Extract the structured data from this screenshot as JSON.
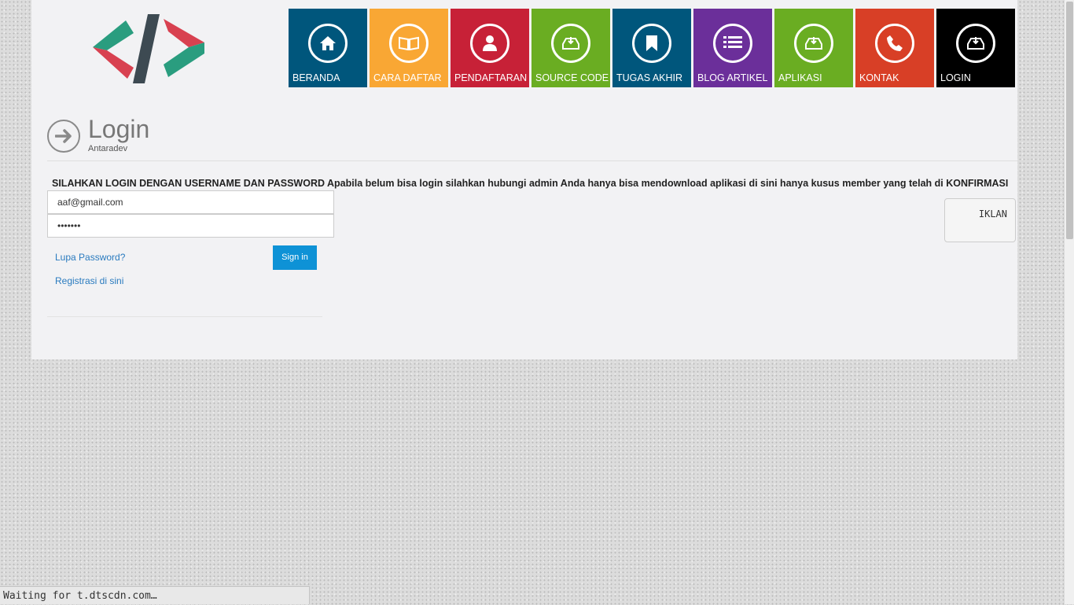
{
  "nav": [
    {
      "label": "BERANDA",
      "color": "#00567c",
      "icon": "home-icon"
    },
    {
      "label": "CARA DAFTAR",
      "color": "#f9a734",
      "icon": "book-icon"
    },
    {
      "label": "PENDAFTARAN",
      "color": "#c72137",
      "icon": "user-icon"
    },
    {
      "label": "SOURCE CODE",
      "color": "#6aad22",
      "icon": "download-tray-icon"
    },
    {
      "label": "TUGAS AKHIR",
      "color": "#00567c",
      "icon": "bookmark-icon"
    },
    {
      "label": "BLOG ARTIKEL",
      "color": "#6b2f9a",
      "icon": "list-icon"
    },
    {
      "label": "APLIKASI",
      "color": "#6aad22",
      "icon": "download-tray-icon"
    },
    {
      "label": "KONTAK",
      "color": "#d83f26",
      "icon": "phone-icon"
    },
    {
      "label": "LOGIN",
      "color": "#000000",
      "icon": "download-tray-icon"
    }
  ],
  "heading": {
    "title": "Login",
    "subtitle": "Antaradev"
  },
  "notice": "SILAHKAN LOGIN DENGAN USERNAME DAN PASSWORD Apabila belum bisa login silahkan hubungi admin Anda hanya bisa mendownload aplikasi di sini hanya kusus member yang telah di KONFIRMASI",
  "form": {
    "email_value": "aaf@gmail.com",
    "password_value": "•••••••",
    "forgot_link": "Lupa Password?",
    "register_link": "Registrasi di sini",
    "signin_label": "Sign in"
  },
  "sidebar": {
    "ad_label": "IKLAN"
  },
  "statusbar": "Waiting for t.dtscdn.com…",
  "colors": {
    "logo_green": "#2a9d7f",
    "logo_red": "#d84150",
    "logo_slash": "#3d4a52"
  }
}
